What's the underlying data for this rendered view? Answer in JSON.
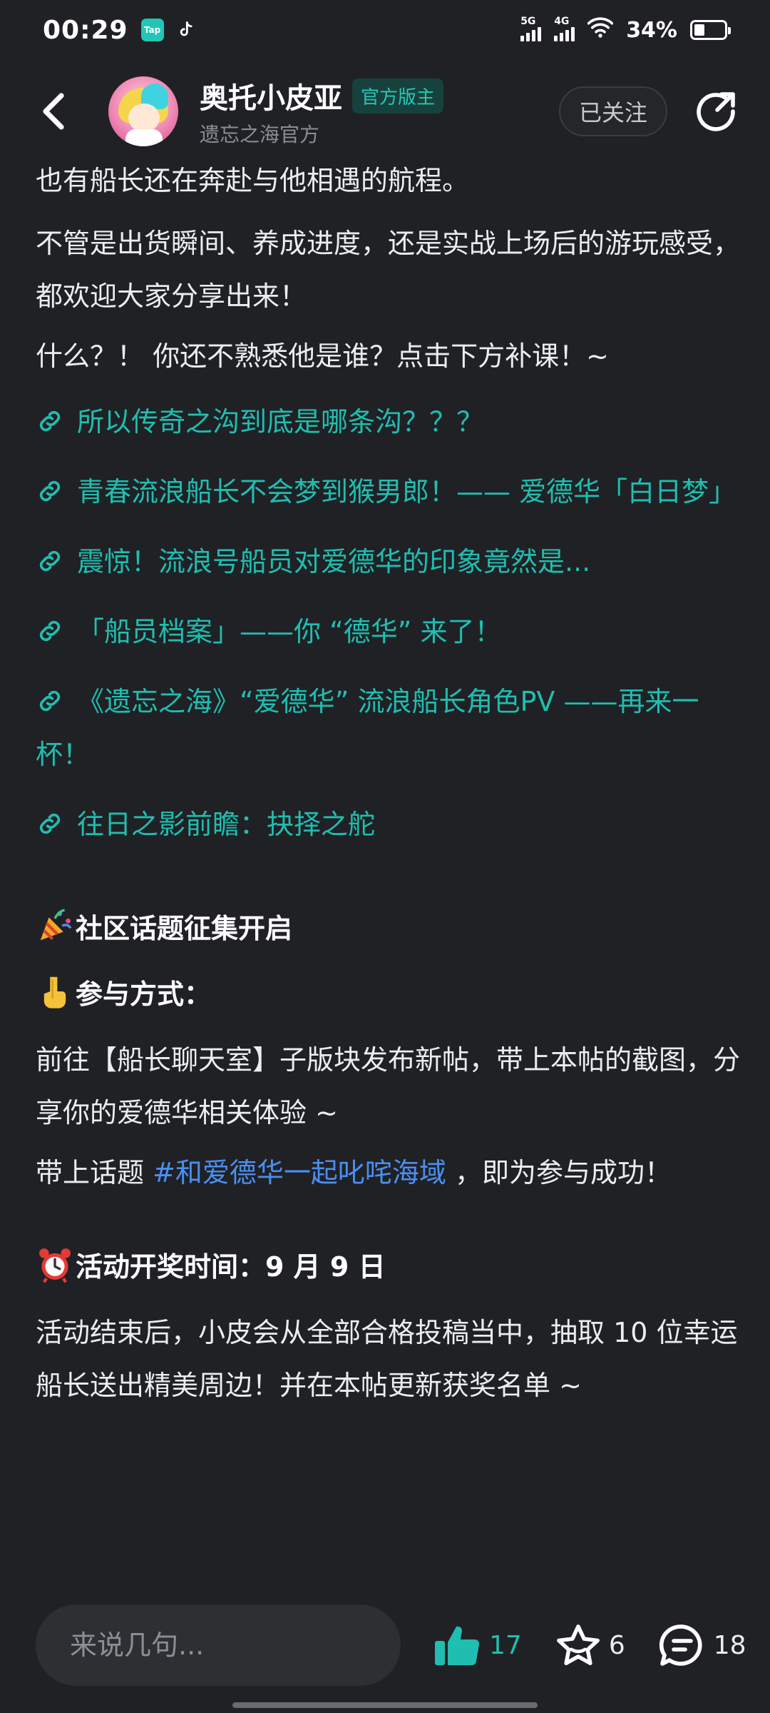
{
  "status_bar": {
    "time": "00:29",
    "app_icon_tap": "Tap",
    "signal1": "5G",
    "signal2": "4G",
    "battery": "34%"
  },
  "header": {
    "user_name": "奥托小皮亚",
    "badge": "官方版主",
    "sub": "遗忘之海官方",
    "follow_label": "已关注"
  },
  "content": {
    "p1": "也有船长还在奔赴与他相遇的航程。",
    "p2": "不管是出货瞬间、养成进度，还是实战上场后的游玩感受，都欢迎大家分享出来！",
    "p3": "什么？！ 你还不熟悉他是谁？点击下方补课！~",
    "links": [
      "所以传奇之沟到底是哪条沟？？？",
      "青春流浪船长不会梦到猴男郎！—— 爱德华「白日梦」",
      "震惊！流浪号船员对爱德华的印象竟然是...",
      "「船员档案」——你 “德华” 来了！",
      "《遗忘之海》“爱德华” 流浪船长角色PV ——再来一杯！",
      "往日之影前瞻：抉择之舵"
    ],
    "topic_title": "社区话题征集开启",
    "how_title": "参与方式：",
    "how_text": "前往【船长聊天室】子版块发布新帖，带上本帖的截图，分享你的爱德华相关体验 ~",
    "hashtag_prefix": "带上话题 ",
    "hashtag": "#和爱德华一起叱咤海域",
    "hashtag_suffix": " ，即为参与成功！",
    "award_title": "活动开奖时间：9 月 9 日",
    "award_text": "活动结束后，小皮会从全部合格投稿当中，抽取 10 位幸运船长送出精美周边！并在本帖更新获奖名单 ~"
  },
  "bottom_bar": {
    "comment_placeholder": "来说几句...",
    "like_count": "17",
    "favorite_count": "6",
    "comment_count": "18"
  },
  "colors": {
    "background": "#202125",
    "link": "#1fbeb0",
    "hashtag": "#4a8ff2",
    "badge_text": "#28c7b4"
  }
}
